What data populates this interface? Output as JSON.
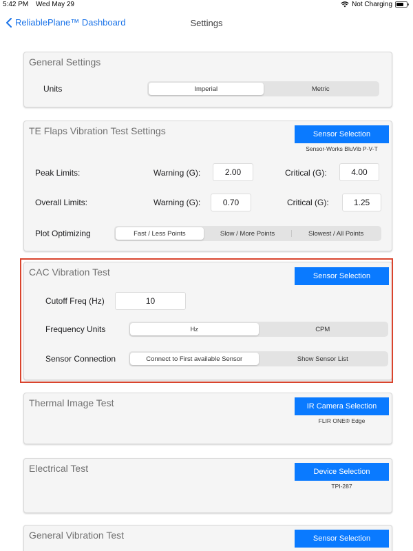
{
  "status": {
    "time": "5:42 PM",
    "date": "Wed May 29",
    "charging": "Not Charging"
  },
  "nav": {
    "back_label": "ReliablePlane™ Dashboard",
    "title": "Settings"
  },
  "general": {
    "title": "General Settings",
    "units_label": "Units",
    "units_options": [
      "Imperial",
      "Metric"
    ]
  },
  "te_flaps": {
    "title": "TE Flaps Vibration Test Settings",
    "sensor_button": "Sensor Selection",
    "sensor_name": "Sensor-Works BluVib P-V-T",
    "peak_label": "Peak Limits:",
    "overall_label": "Overall Limits:",
    "warning_label": "Warning (G):",
    "critical_label": "Critical (G):",
    "peak_warning": "2.00",
    "peak_critical": "4.00",
    "overall_warning": "0.70",
    "overall_critical": "1.25",
    "plot_label": "Plot Optimizing",
    "plot_options": [
      "Fast / Less Points",
      "Slow / More Points",
      "Slowest / All Points"
    ]
  },
  "cac": {
    "title": "CAC Vibration Test",
    "sensor_button": "Sensor Selection",
    "cutoff_label": "Cutoff Freq (Hz)",
    "cutoff_value": "10",
    "freq_units_label": "Frequency Units",
    "freq_units_options": [
      "Hz",
      "CPM"
    ],
    "sensor_conn_label": "Sensor Connection",
    "sensor_conn_options": [
      "Connect to First available Sensor",
      "Show Sensor List"
    ]
  },
  "thermal": {
    "title": "Thermal Image Test",
    "camera_button": "IR Camera Selection",
    "camera_name": "FLIR ONE® Edge"
  },
  "electrical": {
    "title": "Electrical Test",
    "device_button": "Device Selection",
    "device_name": "TPI-287"
  },
  "general_vib": {
    "title": "General Vibration Test",
    "sensor_button": "Sensor Selection"
  },
  "colors": {
    "accent": "#0a7aff",
    "highlight": "#d9442d",
    "link": "#1a73e8"
  }
}
